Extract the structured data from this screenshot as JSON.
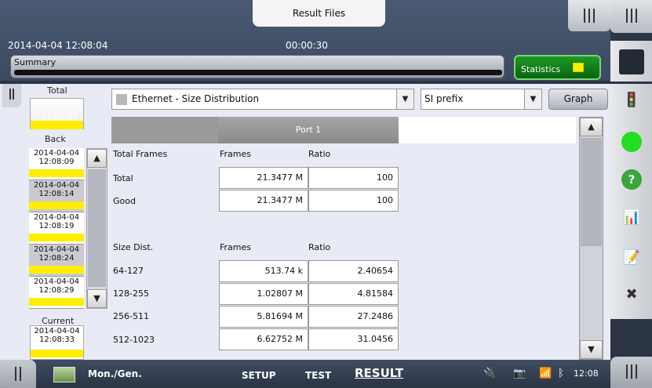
{
  "header": {
    "result_files_tab": "Result Files",
    "datetime": "2014-04-04 12:08:04",
    "elapsed": "00:00:30",
    "summary_label": "Summary",
    "statistics_label": "Statistics"
  },
  "history": {
    "total_label": "Total",
    "total_time": "12:08:04",
    "back_label": "Back",
    "items": [
      {
        "date": "2014-04-04",
        "time": "12:08:09"
      },
      {
        "date": "2014-04-04",
        "time": "12:08:14"
      },
      {
        "date": "2014-04-04",
        "time": "12:08:19"
      },
      {
        "date": "2014-04-04",
        "time": "12:08:24"
      },
      {
        "date": "2014-04-04",
        "time": "12:08:29"
      }
    ],
    "current_label": "Current",
    "current_date": "2014-04-04",
    "current_time": "12:08:33"
  },
  "toolbar": {
    "test_select": "Ethernet - Size Distribution",
    "prefix_select": "SI prefix",
    "graph_button": "Graph"
  },
  "table": {
    "port_header": "Port 1",
    "section1": {
      "label": "Total Frames",
      "col1": "Frames",
      "col2": "Ratio"
    },
    "rows1": [
      {
        "label": "Total",
        "frames": "21.3477 M",
        "ratio": "100"
      },
      {
        "label": "Good",
        "frames": "21.3477 M",
        "ratio": "100"
      }
    ],
    "section2": {
      "label": "Size Dist.",
      "col1": "Frames",
      "col2": "Ratio"
    },
    "rows2": [
      {
        "label": "64-127",
        "frames": "513.74 k",
        "ratio": "2.40654"
      },
      {
        "label": "128-255",
        "frames": "1.02807 M",
        "ratio": "4.81584"
      },
      {
        "label": "256-511",
        "frames": "5.81694 M",
        "ratio": "27.2486"
      },
      {
        "label": "512-1023",
        "frames": "6.62752 M",
        "ratio": "31.0456"
      }
    ]
  },
  "bottom": {
    "mode": "Mon./Gen.",
    "tab_setup": "SETUP",
    "tab_test": "TEST",
    "tab_result": "RESULT",
    "clock": "12:08"
  },
  "colors": {
    "status_yellow": "#ffee00",
    "statistics_green": "#1f9a26",
    "led_green": "#22dd22"
  }
}
